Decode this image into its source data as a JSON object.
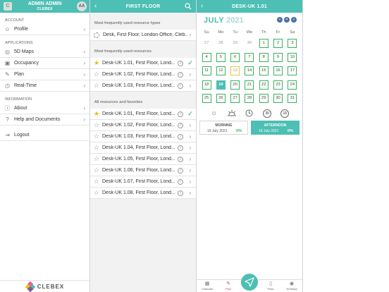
{
  "left": {
    "avatar_initial": "C",
    "user_name": "ADMIN ADMIN",
    "user_org": "CLEBEX",
    "avatar_initials": "AA",
    "section_account": "ACCOUNT",
    "section_applications": "APPLICATIONS",
    "section_information": "INFORMATION",
    "items": [
      {
        "label": "Profile",
        "icon": "user-icon"
      },
      {
        "label": "5D Maps",
        "icon": "map-icon"
      },
      {
        "label": "Occupancy",
        "icon": "occupancy-icon"
      },
      {
        "label": "Plan",
        "icon": "plan-icon"
      },
      {
        "label": "Real-Time",
        "icon": "clock-icon"
      },
      {
        "label": "About",
        "icon": "info-icon"
      },
      {
        "label": "Help and Documents",
        "icon": "help-icon"
      },
      {
        "label": "Logout",
        "icon": "logout-icon"
      }
    ],
    "logo_text": "CLEBEX"
  },
  "mid": {
    "title": "FIRST FLOOR",
    "section_types": "Most frequently used resource types",
    "type_row": "Desk, First Floor, London Office, Cleb...",
    "section_resources": "Most frequently used resources",
    "frequent": [
      {
        "label": "Desk-UK 1.01, First Floor, Lond...",
        "fav": true,
        "selected": true
      },
      {
        "label": "Desk-UK 1.02, First Floor, Lond...",
        "fav": false,
        "selected": false
      },
      {
        "label": "Desk-UK 1.03, First Floor, Lond...",
        "fav": false,
        "selected": false
      }
    ],
    "section_all": "All resources and favorites",
    "all": [
      {
        "label": "Desk-UK 1.01, First Floor, Lond...",
        "fav": true,
        "selected": true
      },
      {
        "label": "Desk-UK 1.02, First Floor, Lond...",
        "fav": false,
        "selected": false
      },
      {
        "label": "Desk-UK 1.03, First Floor, Lond...",
        "fav": false,
        "selected": false
      },
      {
        "label": "Desk-UK 1.04, First Floor, Lond...",
        "fav": false,
        "selected": false
      },
      {
        "label": "Desk-UK 1.05, First Floor, Lond...",
        "fav": false,
        "selected": false
      },
      {
        "label": "Desk-UK 1.06, First Floor, Lond...",
        "fav": false,
        "selected": false
      },
      {
        "label": "Desk-UK 1.07, First Floor, Lond...",
        "fav": false,
        "selected": false
      },
      {
        "label": "Desk-UK 1.08, First Floor, Lond...",
        "fav": false,
        "selected": false
      }
    ]
  },
  "right": {
    "title": "DESK-UK 1.01",
    "month": "JULY",
    "year": "2021",
    "weekdays": [
      "Su",
      "Mo",
      "Tu",
      "We",
      "Th",
      "Fr",
      "Sa"
    ],
    "weeks": [
      [
        {
          "d": "27",
          "s": "muted"
        },
        {
          "d": "28",
          "s": "muted"
        },
        {
          "d": "29",
          "s": "muted"
        },
        {
          "d": "30",
          "s": "muted"
        },
        {
          "d": "1",
          "s": "avail"
        },
        {
          "d": "2",
          "s": "avail"
        },
        {
          "d": "3",
          "s": "avail"
        }
      ],
      [
        {
          "d": "4",
          "s": "avail"
        },
        {
          "d": "5",
          "s": "avail"
        },
        {
          "d": "6",
          "s": "avail"
        },
        {
          "d": "7",
          "s": "avail"
        },
        {
          "d": "8",
          "s": "avail"
        },
        {
          "d": "9",
          "s": "avail"
        },
        {
          "d": "10",
          "s": "avail"
        }
      ],
      [
        {
          "d": "11",
          "s": "avail"
        },
        {
          "d": "12",
          "s": "avail"
        },
        {
          "d": "13",
          "s": "today"
        },
        {
          "d": "14",
          "s": "avail"
        },
        {
          "d": "15",
          "s": "avail"
        },
        {
          "d": "16",
          "s": "avail"
        },
        {
          "d": "17",
          "s": "avail"
        }
      ],
      [
        {
          "d": "18",
          "s": "avail"
        },
        {
          "d": "19",
          "s": "sel"
        },
        {
          "d": "20",
          "s": "avail"
        },
        {
          "d": "21",
          "s": "avail"
        },
        {
          "d": "22",
          "s": "avail"
        },
        {
          "d": "23",
          "s": "avail"
        },
        {
          "d": "24",
          "s": "avail"
        }
      ],
      [
        {
          "d": "25",
          "s": "avail"
        },
        {
          "d": "26",
          "s": "avail"
        },
        {
          "d": "27",
          "s": "avail"
        },
        {
          "d": "28",
          "s": "avail"
        },
        {
          "d": "29",
          "s": "avail"
        },
        {
          "d": "30",
          "s": "avail"
        },
        {
          "d": "31",
          "s": "avail"
        }
      ]
    ],
    "slot_icons": [
      "sun-icon",
      "sunset-icon",
      "clock-icon",
      "30-minutes-icon",
      "15-minutes-icon"
    ],
    "slot_icon_labels": [
      "30",
      "15"
    ],
    "slots": [
      {
        "title": "MORNING",
        "date": "19 July 2021",
        "pct": "0%",
        "active": false
      },
      {
        "title": "AFTERNOON",
        "date": "19 July 2021",
        "pct": "0%",
        "active": true
      }
    ],
    "tabs": [
      {
        "label": "Calendar",
        "icon": "calendar-icon"
      },
      {
        "label": "Plan",
        "icon": "plan-icon"
      },
      {
        "label": "",
        "icon": ""
      },
      {
        "label": "Pass",
        "icon": "pass-icon"
      },
      {
        "label": "5d Maps",
        "icon": "map-icon"
      }
    ]
  },
  "colors": {
    "accent": "#4dbfb4",
    "available": "#35b35a",
    "favorite": "#f2b800",
    "active_tab": "#c03780"
  }
}
